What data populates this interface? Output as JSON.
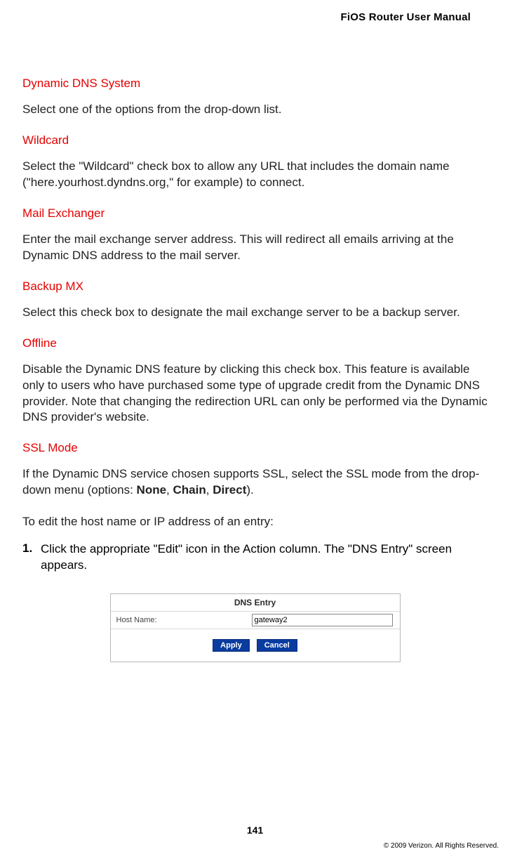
{
  "header": {
    "doc_title": "FiOS Router User Manual"
  },
  "sections": {
    "ddns": {
      "heading": "Dynamic DNS System",
      "text": "Select one of the options from the drop-down list."
    },
    "wildcard": {
      "heading": "Wildcard",
      "text": "Select the \"Wildcard\" check box to allow any URL that includes the domain name (\"here.yourhost.dyndns.org,\" for example) to connect."
    },
    "mail_exchanger": {
      "heading": "Mail Exchanger",
      "text": "Enter the mail exchange server address. This will redirect all emails arriving at the Dynamic DNS address to the mail server."
    },
    "backup_mx": {
      "heading": "Backup MX",
      "text": "Select this check box to designate the mail exchange server to be a backup server."
    },
    "offline": {
      "heading": "Offline",
      "text": "Disable the Dynamic DNS feature by clicking this check box. This feature is available only to users who have purchased some type of upgrade credit from the Dynamic DNS provider. Note that changing the redirection URL can only be performed via the Dynamic DNS provider's website."
    },
    "ssl_mode": {
      "heading": "SSL Mode",
      "text_before": "If the Dynamic DNS service chosen supports SSL, select the SSL mode from the drop-down menu (options: ",
      "opt_none": "None",
      "opt_chain": "Chain",
      "opt_direct": "Direct",
      "text_after": ")."
    },
    "edit_intro": "To edit the host name or IP address of an entry:",
    "step1": {
      "num": "1.",
      "text": "Click the appropriate \"Edit\" icon in the Action column. The \"DNS Entry\" screen appears."
    }
  },
  "figure": {
    "title": "DNS Entry",
    "host_label": "Host Name:",
    "host_value": "gateway2",
    "apply": "Apply",
    "cancel": "Cancel"
  },
  "footer": {
    "page_number": "141",
    "copyright": "© 2009 Verizon. All Rights Reserved."
  }
}
